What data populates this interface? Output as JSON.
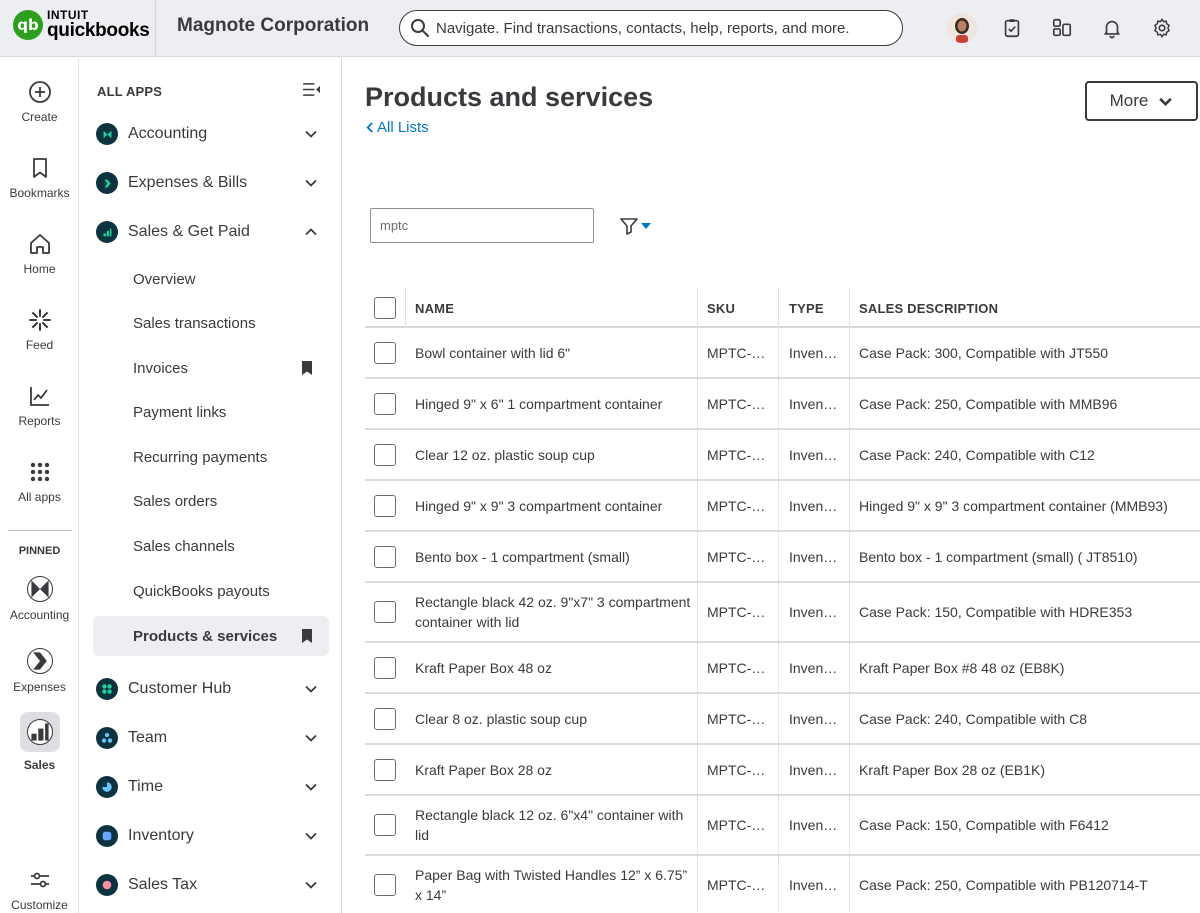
{
  "brand": {
    "intuit": "INTUIT",
    "quickbooks": "quickbooks",
    "mark": "qb"
  },
  "company": "Magnote Corporation",
  "search": {
    "placeholder": "Navigate. Find transactions, contacts, help, reports, and more."
  },
  "top_icons": [
    "avatar",
    "clipboard-check-icon",
    "apps-grid-icon",
    "bell-icon",
    "gear-icon"
  ],
  "rail": {
    "items": [
      {
        "label": "Create",
        "icon": "plus-circle-icon"
      },
      {
        "label": "Bookmarks",
        "icon": "bookmark-icon"
      },
      {
        "label": "Home",
        "icon": "home-icon"
      },
      {
        "label": "Feed",
        "icon": "feed-icon"
      },
      {
        "label": "Reports",
        "icon": "chart-line-icon"
      },
      {
        "label": "All apps",
        "icon": "grid-dots-icon"
      }
    ],
    "pinned_label": "PINNED",
    "pinned": [
      {
        "label": "Accounting"
      },
      {
        "label": "Expenses"
      },
      {
        "label": "Sales"
      }
    ],
    "customize": "Customize"
  },
  "apps": {
    "heading": "ALL APPS",
    "accounting": "Accounting",
    "expenses": "Expenses & Bills",
    "sales": "Sales & Get Paid",
    "sales_sub": [
      "Overview",
      "Sales transactions",
      "Invoices",
      "Payment links",
      "Recurring payments",
      "Sales orders",
      "Sales channels",
      "QuickBooks payouts",
      "Products & services"
    ],
    "customer_hub": "Customer Hub",
    "team": "Team",
    "time": "Time",
    "inventory": "Inventory",
    "sales_tax": "Sales Tax"
  },
  "main": {
    "title": "Products and services",
    "back_link": "All Lists",
    "more_label": "More",
    "filter_value": "mptc"
  },
  "table": {
    "headers": {
      "name": "NAME",
      "sku": "SKU",
      "type": "TYPE",
      "desc": "SALES DESCRIPTION"
    },
    "rows": [
      {
        "name": "Bowl container with lid 6\"",
        "sku": "MPTC-…",
        "type": "Inven…",
        "desc": "Case Pack: 300, Compatible with JT550"
      },
      {
        "name": "Hinged 9\" x 6\" 1 compartment container",
        "sku": "MPTC-…",
        "type": "Inven…",
        "desc": "Case Pack: 250, Compatible with MMB96"
      },
      {
        "name": "Clear 12 oz. plastic soup cup",
        "sku": "MPTC-…",
        "type": "Inven…",
        "desc": "Case Pack: 240, Compatible with C12"
      },
      {
        "name": "Hinged 9\" x 9\" 3 compartment container",
        "sku": "MPTC-…",
        "type": "Inven…",
        "desc": "Hinged 9\" x 9\" 3 compartment container (MMB93)"
      },
      {
        "name": "Bento box - 1 compartment (small)",
        "sku": "MPTC-…",
        "type": "Inven…",
        "desc": "Bento box - 1 compartment (small) ( JT8510)"
      },
      {
        "name": "Rectangle black 42 oz. 9\"x7\" 3 compartment container with lid",
        "sku": "MPTC-…",
        "type": "Inven…",
        "desc": "Case Pack: 150, Compatible with HDRE353"
      },
      {
        "name": "Kraft Paper Box 48 oz",
        "sku": "MPTC-…",
        "type": "Inven…",
        "desc": "Kraft Paper Box #8 48 oz (EB8K)"
      },
      {
        "name": "Clear 8 oz. plastic soup cup",
        "sku": "MPTC-…",
        "type": "Inven…",
        "desc": "Case Pack: 240, Compatible with C8"
      },
      {
        "name": "Kraft Paper Box 28 oz",
        "sku": "MPTC-…",
        "type": "Inven…",
        "desc": "Kraft Paper Box 28 oz (EB1K)"
      },
      {
        "name": "Rectangle black 12 oz. 6\"x4\" container with lid",
        "sku": "MPTC-…",
        "type": "Inven…",
        "desc": "Case Pack: 150, Compatible with F6412"
      },
      {
        "name": "Paper Bag with Twisted Handles 12” x 6.75” x 14”",
        "sku": "MPTC-…",
        "type": "Inven…",
        "desc": "Case Pack: 250, Compatible with PB120714-T"
      }
    ]
  },
  "colors": {
    "accent_link": "#0077c5",
    "brand_green": "#2ca01c",
    "app_icon_bg": "#0d333f"
  }
}
